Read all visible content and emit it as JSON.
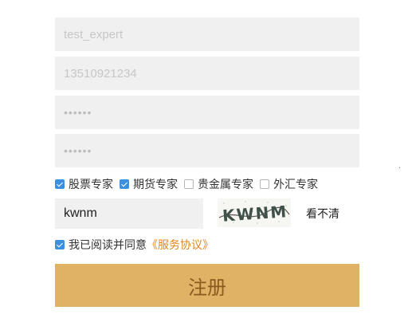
{
  "form": {
    "username": "test_expert",
    "phone": "13510921234",
    "password": "••••••",
    "confirm_password": "••••••"
  },
  "categories": [
    {
      "label": "股票专家",
      "checked": true
    },
    {
      "label": "期货专家",
      "checked": true
    },
    {
      "label": "贵金属专家",
      "checked": false
    },
    {
      "label": "外汇专家",
      "checked": false
    }
  ],
  "captcha": {
    "value": "kwnm",
    "image_text": "KWNM",
    "refresh_label": "看不清"
  },
  "agreement": {
    "checked": true,
    "text": "我已阅读并同意",
    "link_label": "《服务协议》"
  },
  "submit_label": "注册",
  "colors": {
    "field_bg": "#f0f0f0",
    "checkbox_accent": "#3d8fe0",
    "link": "#e0851e",
    "button_bg": "#dfb266",
    "button_text": "#8a5a1e"
  }
}
